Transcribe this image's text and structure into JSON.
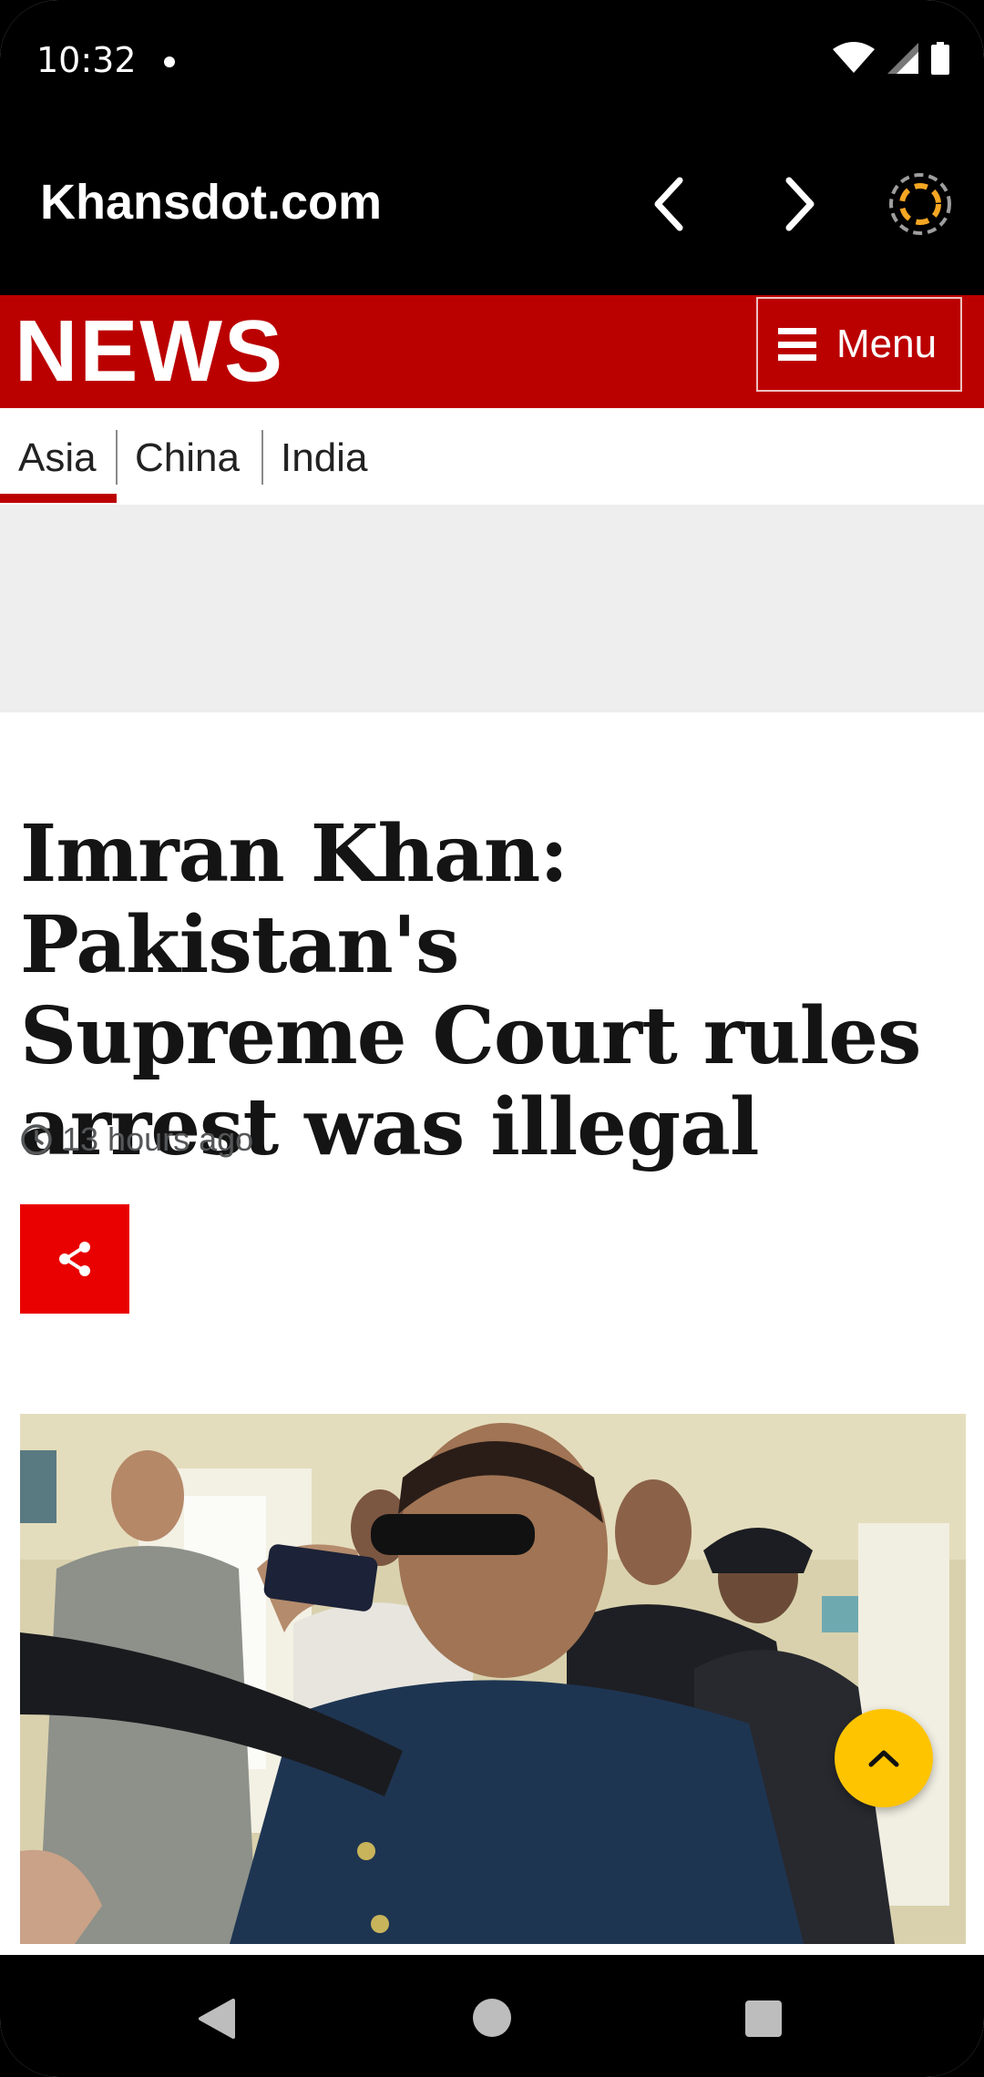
{
  "status_bar": {
    "time": "10:32",
    "icons": [
      "notification-dot",
      "wifi-icon",
      "signal-icon",
      "battery-icon"
    ]
  },
  "browser": {
    "title": "Khansdot.com",
    "icons": [
      "back-arrow-icon",
      "forward-arrow-icon",
      "extension-icon"
    ]
  },
  "header": {
    "logo": "NEWS",
    "menu_label": "Menu",
    "brand_color": "#bb0000"
  },
  "subnav": {
    "items": [
      {
        "label": "Asia",
        "active": true
      },
      {
        "label": "China",
        "active": false
      },
      {
        "label": "India",
        "active": false
      }
    ]
  },
  "article": {
    "headline_lines": [
      "Imran Khan: Pakistan's",
      "Supreme Court rules",
      "arrest was illegal"
    ],
    "timestamp": "13 hours ago",
    "share_color": "#e90000",
    "scroll_top_color": "#ffc400"
  },
  "nav_bar": {
    "icons": [
      "back-triangle-icon",
      "home-circle-icon",
      "recents-square-icon"
    ]
  }
}
